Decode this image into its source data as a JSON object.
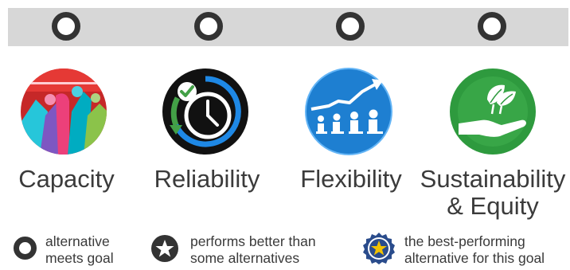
{
  "categories": [
    {
      "label": "Capacity",
      "icon": "crowded-train-icon"
    },
    {
      "label": "Reliability",
      "icon": "clock-check-icon"
    },
    {
      "label": "Flexibility",
      "icon": "rising-seats-icon"
    },
    {
      "label_line1": "Sustainability",
      "label_line2": "& Equity",
      "icon": "hand-leaf-icon"
    }
  ],
  "legend": [
    {
      "line1": "alternative",
      "line2": "meets goal",
      "icon": "ring-icon"
    },
    {
      "line1": "performs better than",
      "line2": "some alternatives",
      "icon": "star-circle-icon"
    },
    {
      "line1": "the best-performing",
      "line2": "alternative for this goal",
      "icon": "star-badge-icon"
    }
  ],
  "colors": {
    "bar": "#d7d7d7",
    "ring": "#333333",
    "text": "#3a3a3a",
    "capacity": "#c0392b",
    "reliability": "#1a1a1a",
    "flexibility": "#1e7fd1",
    "sustainability": "#2e9a3e",
    "badge_gold": "#f2c200",
    "badge_blue": "#2a4c8c"
  }
}
